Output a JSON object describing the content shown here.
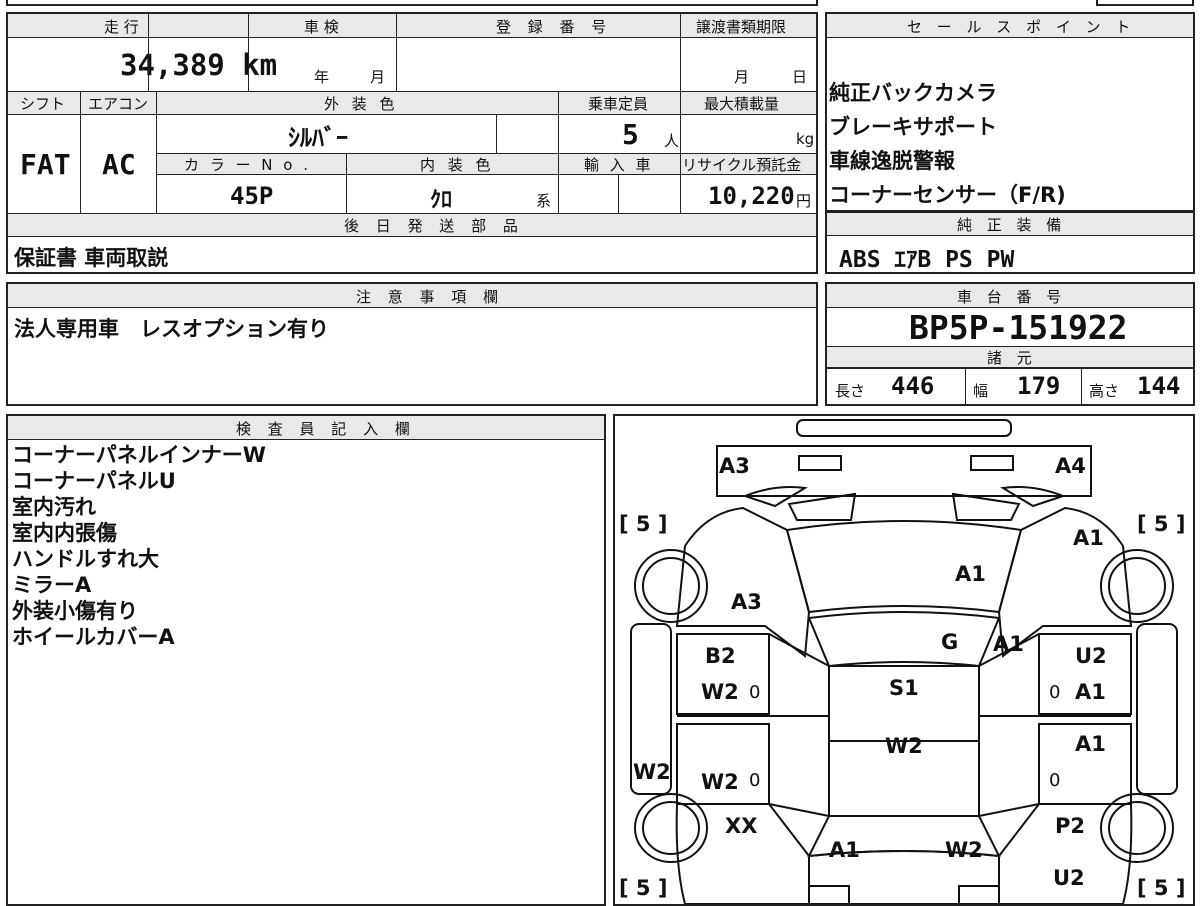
{
  "vehicle": {
    "mileage_label": "走 行",
    "mileage_value": "34,389 km",
    "inspection_label": "車 検",
    "inspection_year_unit": "年",
    "inspection_month_unit": "月",
    "registration_label": "登 録 番 号",
    "transfer_deadline_label": "譲渡書類期限",
    "transfer_month_unit": "月",
    "transfer_day_unit": "日",
    "shift_label": "シフト",
    "shift_value": "FAT",
    "ac_label": "エアコン",
    "ac_value": "AC",
    "exterior_color_label": "外 装 色",
    "exterior_color_value": "ｼﾙﾊﾞｰ",
    "capacity_label": "乗車定員",
    "capacity_value": "5",
    "capacity_unit": "人",
    "max_load_label": "最大積載量",
    "max_load_unit": "kg",
    "color_no_label": "カ ラ ー N o .",
    "color_no_value": "45P",
    "interior_color_label": "内 装 色",
    "interior_color_value": "ｸﾛ",
    "interior_color_suffix": "系",
    "import_label": "輸 入 車",
    "recycle_label": "リサイクル預託金",
    "recycle_value": "10,220",
    "recycle_unit": "円"
  },
  "sales_points": {
    "label": "セ ー ル ス ポ イ ン ト",
    "items": [
      "純正バックカメラ",
      "ブレーキサポート",
      "車線逸脱警報",
      "コーナーセンサー（F/R)"
    ]
  },
  "later_parts": {
    "label": "後 日 発 送 部 品",
    "value": "保証書 車両取説"
  },
  "standard_equipment": {
    "label": "純 正 装 備",
    "value": "ABS ｴｱB PS PW"
  },
  "notes_section": {
    "label": "注 意 事 項 欄",
    "value": "法人専用車　レスオプション有り"
  },
  "chassis": {
    "label": "車 台 番 号",
    "value": "BP5P-151922",
    "specs_label": "諸 元",
    "length_label": "長さ",
    "length_value": "446",
    "width_label": "幅",
    "width_value": "179",
    "height_label": "高さ",
    "height_value": "144"
  },
  "inspector": {
    "label": "検 査 員 記 入 欄",
    "lines": [
      "コーナーパネルインナーW",
      "コーナーパネルU",
      "室内汚れ",
      "室内内張傷",
      "ハンドルすれ大",
      "ミラーA",
      "外装小傷有り",
      "ホイールカバーA"
    ]
  },
  "diagram": {
    "labels": {
      "front_left_corner": "A3",
      "front_right_corner": "A4",
      "hood": "A1",
      "left_front_fender": "A3",
      "right_front_fender": "A1",
      "windshield": "G",
      "windshield_right": "A1",
      "left_front_door_1": "B2",
      "left_front_door_2": "W2",
      "roof": "S1",
      "right_front_door_1": "U2",
      "right_front_door_2": "A1",
      "left_sill": "W2",
      "left_rear_door": "W2",
      "roof_rear": "W2",
      "right_rear_door": "A1",
      "left_rear_fender": "XX",
      "right_rear_fender": "P2",
      "trunk": "A1",
      "trunk_right": "W2",
      "right_rear_corner": "U2",
      "marker_0": "0"
    },
    "tires": {
      "front_left": "5",
      "front_right": "5",
      "rear_left": "5",
      "rear_right": "5"
    }
  }
}
